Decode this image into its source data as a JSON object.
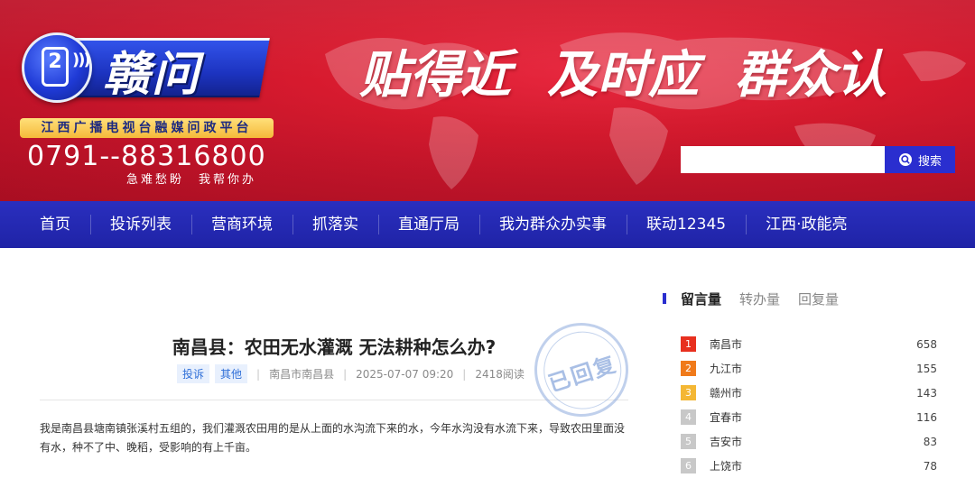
{
  "banner": {
    "logo_text": "赣问",
    "logo_phone_num": "2",
    "platform_label": "江西广播电视台融媒问政平台",
    "hotline": "0791--88316800",
    "hotline_sub": "急难愁盼　我帮你办",
    "slogan": [
      "贴得近",
      "及时应",
      "群众认"
    ],
    "colors": {
      "red": "#d71a2e",
      "blue": "#2a2ecf",
      "gold": "#f5b93a"
    }
  },
  "search": {
    "placeholder": "",
    "button_label": "搜索",
    "icon": "search-icon"
  },
  "nav": {
    "items": [
      "首页",
      "投诉列表",
      "营商环境",
      "抓落实",
      "直通厅局",
      "我为群众办实事",
      "联动12345",
      "江西·政能亮"
    ]
  },
  "article": {
    "title": "南昌县：农田无水灌溉 无法耕种怎么办?",
    "tags": [
      "投诉",
      "其他"
    ],
    "location": "南昌市南昌县",
    "datetime": "2025-07-07 09:20",
    "reads": "2418阅读",
    "body": "我是南昌县塘南镇张溪村五组的，我们灌溉农田用的是从上面的水沟流下来的水，今年水沟没有水流下来，导致农田里面没有水，种不了中、晚稻，受影响的有上千亩。",
    "stamp": "已回复"
  },
  "ranking": {
    "tabs": [
      "留言量",
      "转办量",
      "回复量"
    ],
    "active_tab": 0,
    "rows": [
      {
        "rank": "1",
        "city": "南昌市",
        "count": "658",
        "color": "#e8301f"
      },
      {
        "rank": "2",
        "city": "九江市",
        "count": "155",
        "color": "#f07a1a"
      },
      {
        "rank": "3",
        "city": "赣州市",
        "count": "143",
        "color": "#f4b734"
      },
      {
        "rank": "4",
        "city": "宜春市",
        "count": "116",
        "color": "#c8c8c8"
      },
      {
        "rank": "5",
        "city": "吉安市",
        "count": "83",
        "color": "#c8c8c8"
      },
      {
        "rank": "6",
        "city": "上饶市",
        "count": "78",
        "color": "#c8c8c8"
      }
    ]
  }
}
